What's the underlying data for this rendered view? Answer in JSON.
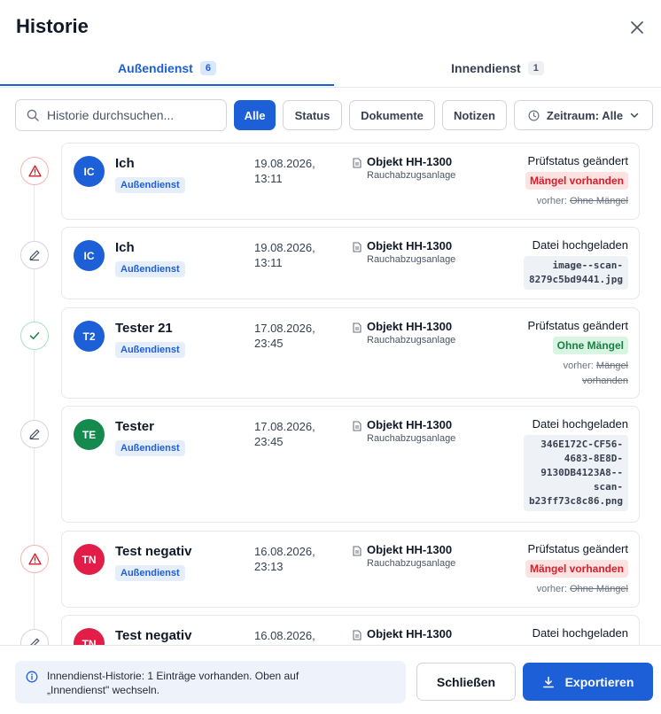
{
  "dialog": {
    "title": "Historie",
    "close_icon": "close-icon"
  },
  "tabs": [
    {
      "label": "Außendienst",
      "count": "6"
    },
    {
      "label": "Innendienst",
      "count": "1"
    }
  ],
  "toolbar": {
    "search_placeholder": "Historie durchsuchen...",
    "filters": [
      "Alle",
      "Status",
      "Dokumente",
      "Notizen"
    ],
    "period_label": "Zeitraum: Alle"
  },
  "entries": [
    {
      "marker": "warning-icon",
      "initials": "IC",
      "avatar_color": "#1d5fd6",
      "user": "Ich",
      "role": "Außendienst",
      "date": "19.08.2026,",
      "time": "13:11",
      "object": "Objekt HH-1300",
      "object_sub": "Rauchabzugsanlage",
      "action": "Prüfstatus geändert",
      "status": "Mängel vorhanden",
      "prev_label": "vorher:",
      "prev_value": "Ohne Mängel"
    },
    {
      "marker": "pencil-icon",
      "initials": "IC",
      "avatar_color": "#1d5fd6",
      "user": "Ich",
      "role": "Außendienst",
      "date": "19.08.2026,",
      "time": "13:11",
      "object": "Objekt HH-1300",
      "object_sub": "Rauchabzugsanlage",
      "action": "Datei hochgeladen",
      "file_lines": [
        "image--scan-",
        "8279c5bd9441.jpg"
      ]
    },
    {
      "marker": "check-icon",
      "initials": "T2",
      "avatar_color": "#1d5fd6",
      "user": "Tester 21",
      "role": "Außendienst",
      "date": "17.08.2026,",
      "time": "23:45",
      "object": "Objekt HH-1300",
      "object_sub": "Rauchabzugsanlage",
      "action": "Prüfstatus geändert",
      "status": "Ohne Mängel",
      "prev_label": "vorher:",
      "prev_value": "Mängel vorhanden"
    },
    {
      "marker": "pencil-icon",
      "initials": "TE",
      "avatar_color": "#158a4e",
      "user": "Tester",
      "role": "Außendienst",
      "date": "17.08.2026,",
      "time": "23:45",
      "object": "Objekt HH-1300",
      "object_sub": "Rauchabzugsanlage",
      "action": "Datei hochgeladen",
      "file_lines": [
        "346E172C-CF56-",
        "4683-8E8D-",
        "9130DB4123A8--",
        "scan-",
        "b23ff73c8c86.png"
      ]
    },
    {
      "marker": "warning-icon",
      "initials": "TN",
      "avatar_color": "#e11d48",
      "user": "Test negativ",
      "role": "Außendienst",
      "date": "16.08.2026,",
      "time": "23:13",
      "object": "Objekt HH-1300",
      "object_sub": "Rauchabzugsanlage",
      "action": "Prüfstatus geändert",
      "status": "Mängel vorhanden",
      "prev_label": "vorher:",
      "prev_value": "Ohne Mängel"
    },
    {
      "marker": "pencil-icon",
      "initials": "TN",
      "avatar_color": "#e11d48",
      "user": "Test negativ",
      "date": "16.08.2026,",
      "object": "Objekt HH-1300",
      "action": "Datei hochgeladen"
    }
  ],
  "footer": {
    "info_text_1": "Innendienst-Historie: 1 Einträge vorhanden. Oben auf",
    "info_text_2": "„Innendienst\" wechseln.",
    "close_label": "Schließen",
    "export_label": "Exportieren"
  },
  "colors": {
    "accent": "#1d5fd6",
    "danger": "#d41f2b",
    "success": "#1a7f46"
  }
}
